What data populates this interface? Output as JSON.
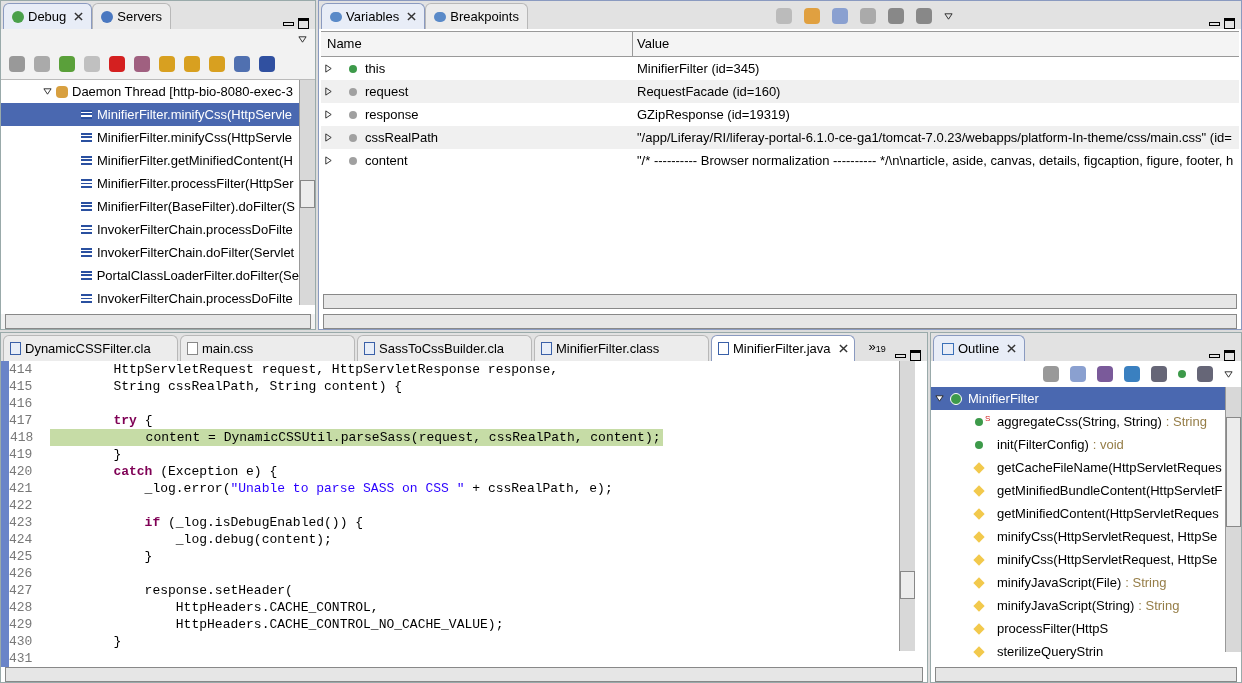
{
  "debug_view": {
    "tabs": [
      {
        "label": "Debug",
        "selected": true
      },
      {
        "label": "Servers",
        "selected": false
      }
    ],
    "thread": {
      "label": "Daemon Thread [http-bio-8080-exec-3",
      "expanded": true,
      "children": [
        {
          "label": "MinifierFilter.minifyCss(HttpServle",
          "selected": true
        },
        {
          "label": "MinifierFilter.minifyCss(HttpServle",
          "selected": false
        },
        {
          "label": "MinifierFilter.getMinifiedContent(H",
          "selected": false
        },
        {
          "label": "MinifierFilter.processFilter(HttpSer",
          "selected": false
        },
        {
          "label": "MinifierFilter(BaseFilter).doFilter(S",
          "selected": false
        },
        {
          "label": "InvokerFilterChain.processDoFilte",
          "selected": false
        },
        {
          "label": "InvokerFilterChain.doFilter(Servlet",
          "selected": false
        },
        {
          "label": "PortalClassLoaderFilter.doFilter(Se",
          "selected": false
        },
        {
          "label": "InvokerFilterChain.processDoFilte",
          "selected": false
        }
      ]
    }
  },
  "variables_view": {
    "tabs": [
      {
        "label": "Variables",
        "selected": true
      },
      {
        "label": "Breakpoints",
        "selected": false
      }
    ],
    "columns": [
      "Name",
      "Value"
    ],
    "rows": [
      {
        "name": "this",
        "value": "MinifierFilter  (id=345)",
        "kind": "object"
      },
      {
        "name": "request",
        "value": "RequestFacade  (id=160)",
        "kind": "local"
      },
      {
        "name": "response",
        "value": "GZipResponse  (id=19319)",
        "kind": "local"
      },
      {
        "name": "cssRealPath",
        "value": "\"/app/Liferay/RI/liferay-portal-6.1.0-ce-ga1/tomcat-7.0.23/webapps/platform-In-theme/css/main.css\" (id=",
        "kind": "local"
      },
      {
        "name": "content",
        "value": "\"/* ---------- Browser normalization ---------- */\\n\\narticle, aside, canvas, details, figcaption, figure, footer, h",
        "kind": "local"
      }
    ]
  },
  "editor": {
    "tabs": [
      {
        "label": "DynamicCSSFilter.cla",
        "kind": "class",
        "selected": false
      },
      {
        "label": "main.css",
        "kind": "text",
        "selected": false
      },
      {
        "label": "SassToCssBuilder.cla",
        "kind": "class",
        "selected": false
      },
      {
        "label": "MinifierFilter.class",
        "kind": "class",
        "selected": false
      },
      {
        "label": "MinifierFilter.java",
        "kind": "java",
        "selected": true
      }
    ],
    "overflow_marker": "»",
    "overflow_count": "19",
    "lines": [
      {
        "number": "414",
        "current": false,
        "segments": [
          {
            "kind": "plain",
            "text": "        HttpServletRequest request, HttpServletResponse response,"
          }
        ]
      },
      {
        "number": "415",
        "current": false,
        "segments": [
          {
            "kind": "plain",
            "text": "        String cssRealPath, String content) {"
          }
        ]
      },
      {
        "number": "416",
        "current": false
      },
      {
        "number": "417",
        "current": false,
        "segments": [
          {
            "kind": "keyword",
            "text": "        try"
          },
          {
            "kind": "plain",
            "text": " {"
          }
        ]
      },
      {
        "number": "418",
        "current": true,
        "segments": [
          {
            "kind": "plain",
            "text": "            content = DynamicCSSUtil.parseSass(request, cssRealPath, content);"
          }
        ]
      },
      {
        "number": "419",
        "current": false,
        "segments": [
          {
            "kind": "plain",
            "text": "        }"
          }
        ]
      },
      {
        "number": "420",
        "current": false,
        "segments": [
          {
            "kind": "keyword",
            "text": "        catch"
          },
          {
            "kind": "plain",
            "text": " (Exception e) {"
          }
        ]
      },
      {
        "number": "421",
        "current": false,
        "segments": [
          {
            "kind": "plain",
            "text": "            _log.error("
          },
          {
            "kind": "string",
            "text": "\"Unable to parse SASS on CSS \""
          },
          {
            "kind": "plain",
            "text": " + cssRealPath, e);"
          }
        ]
      },
      {
        "number": "422",
        "current": false
      },
      {
        "number": "423",
        "current": false,
        "segments": [
          {
            "kind": "keyword",
            "text": "            if"
          },
          {
            "kind": "plain",
            "text": " (_log.isDebugEnabled()) {"
          }
        ]
      },
      {
        "number": "424",
        "current": false,
        "segments": [
          {
            "kind": "plain",
            "text": "                _log.debug(content);"
          }
        ]
      },
      {
        "number": "425",
        "current": false,
        "segments": [
          {
            "kind": "plain",
            "text": "            }"
          }
        ]
      },
      {
        "number": "426",
        "current": false
      },
      {
        "number": "427",
        "current": false,
        "segments": [
          {
            "kind": "plain",
            "text": "            response.setHeader("
          }
        ]
      },
      {
        "number": "428",
        "current": false,
        "segments": [
          {
            "kind": "plain",
            "text": "                HttpHeaders.CACHE_CONTROL,"
          }
        ]
      },
      {
        "number": "429",
        "current": false,
        "segments": [
          {
            "kind": "plain",
            "text": "                HttpHeaders.CACHE_CONTROL_NO_CACHE_VALUE);"
          }
        ]
      },
      {
        "number": "430",
        "current": false,
        "segments": [
          {
            "kind": "plain",
            "text": "        }"
          }
        ]
      },
      {
        "number": "431",
        "current": false
      }
    ]
  },
  "outline_view": {
    "tabs": [
      {
        "label": "Outline",
        "selected": true
      }
    ],
    "root": {
      "label": "MinifierFilter",
      "expanded": true,
      "selected": true,
      "children": [
        {
          "label": "aggregateCss(String, String)",
          "type": ": String",
          "kind": "public",
          "static_marker": "S"
        },
        {
          "label": "init(FilterConfig)",
          "type": ": void",
          "kind": "public"
        },
        {
          "label": "getCacheFileName(HttpServletReques",
          "kind": "default"
        },
        {
          "label": "getMinifiedBundleContent(HttpServletF",
          "kind": "default"
        },
        {
          "label": "getMinifiedContent(HttpServletReques",
          "kind": "default"
        },
        {
          "label": "minifyCss(HttpServletRequest, HttpSe",
          "kind": "default"
        },
        {
          "label": "minifyCss(HttpServletRequest, HttpSe",
          "kind": "default"
        },
        {
          "label": "minifyJavaScript(File)",
          "type": ": String",
          "kind": "default"
        },
        {
          "label": "minifyJavaScript(String)",
          "type": ": String",
          "kind": "default"
        },
        {
          "label": "processFilter(HttpS",
          "kind": "default"
        },
        {
          "label": "sterilizeQueryStrin",
          "kind": "default"
        }
      ]
    }
  }
}
